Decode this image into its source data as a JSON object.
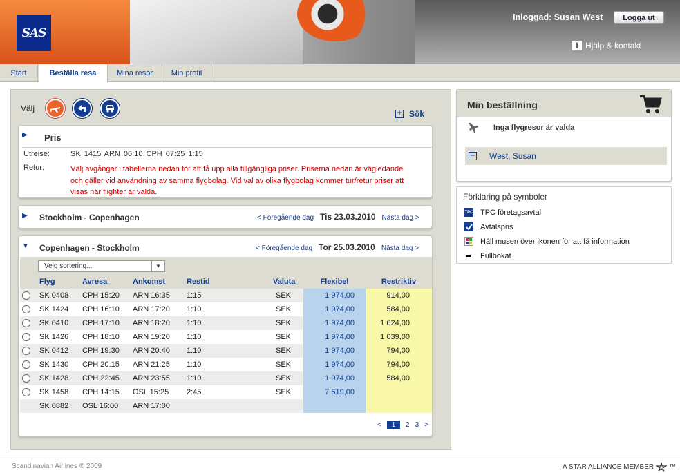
{
  "brand": {
    "logo_text": "SAS",
    "orange": "#e8642a",
    "blue": "#123d91"
  },
  "header": {
    "logged_in": "Inloggad: Susan West",
    "logout": "Logga ut",
    "help": "Hjälp & kontakt"
  },
  "nav": {
    "tabs": [
      {
        "label": "Start",
        "active": false
      },
      {
        "label": "Beställa resa",
        "active": true
      },
      {
        "label": "Mina resor",
        "active": false
      },
      {
        "label": "Min profil",
        "active": false
      }
    ]
  },
  "search_bar": {
    "choose_label": "Välj",
    "modes": [
      "airplane-icon",
      "hotel-icon",
      "car-icon"
    ],
    "search_label": "Sök"
  },
  "price_panel": {
    "title": "Pris",
    "outbound_label": "Utreise:",
    "outbound_value": "SK 1415  ARN 06:10  CPH 07:25  1:15",
    "return_label": "Retur:",
    "return_message": "Välj avgångar i tabellerna nedan för att få upp alla tillgängliga priser. Priserna nedan är vägledande och gäller vid användning av samma flygbolag. Vid val av olika flygbolag kommer tur/retur priser att visas när flighter är valda."
  },
  "leg_outbound": {
    "title": "Stockholm - Copenhagen",
    "prev": "< Föregående dag",
    "date": "Tis 23.03.2010",
    "next": "Nästa dag >"
  },
  "leg_return": {
    "title": "Copenhagen - Stockholm",
    "prev": "< Föregående dag",
    "date": "Tor 25.03.2010",
    "next": "Nästa dag >",
    "sort_placeholder": "Velg sortering...",
    "columns": [
      "Flyg",
      "Avresa",
      "Ankomst",
      "Restid",
      "Valuta",
      "Flexibel",
      "Restriktiv"
    ],
    "rows": [
      {
        "flight": "SK 0408",
        "dep": "CPH 15:20",
        "arr": "ARN 16:35",
        "time": "1:15",
        "cur": "SEK",
        "flex": "1 974,00",
        "restr": "914,00",
        "radio": true
      },
      {
        "flight": "SK 1424",
        "dep": "CPH 16:10",
        "arr": "ARN 17:20",
        "time": "1:10",
        "cur": "SEK",
        "flex": "1 974,00",
        "restr": "584,00",
        "radio": true
      },
      {
        "flight": "SK 0410",
        "dep": "CPH 17:10",
        "arr": "ARN 18:20",
        "time": "1:10",
        "cur": "SEK",
        "flex": "1 974,00",
        "restr": "1 624,00",
        "radio": true
      },
      {
        "flight": "SK 1426",
        "dep": "CPH 18:10",
        "arr": "ARN 19:20",
        "time": "1:10",
        "cur": "SEK",
        "flex": "1 974,00",
        "restr": "1 039,00",
        "radio": true
      },
      {
        "flight": "SK 0412",
        "dep": "CPH 19:30",
        "arr": "ARN 20:40",
        "time": "1:10",
        "cur": "SEK",
        "flex": "1 974,00",
        "restr": "794,00",
        "radio": true
      },
      {
        "flight": "SK 1430",
        "dep": "CPH 20:15",
        "arr": "ARN 21:25",
        "time": "1:10",
        "cur": "SEK",
        "flex": "1 974,00",
        "restr": "794,00",
        "radio": true
      },
      {
        "flight": "SK 1428",
        "dep": "CPH 22:45",
        "arr": "ARN 23:55",
        "time": "1:10",
        "cur": "SEK",
        "flex": "1 974,00",
        "restr": "584,00",
        "radio": true
      },
      {
        "flight": "SK 1458",
        "dep": "CPH 14:15",
        "arr": "OSL 15:25",
        "time": "2:45",
        "cur": "SEK",
        "flex": "7 619,00",
        "restr": "",
        "radio": true
      },
      {
        "flight": "SK 0882",
        "dep": "OSL 16:00",
        "arr": "ARN 17:00",
        "time": "",
        "cur": "",
        "flex": "",
        "restr": "",
        "radio": false
      }
    ],
    "pager": {
      "prev": "<",
      "pages": [
        "1",
        "2",
        "3"
      ],
      "current": "1",
      "next": ">"
    }
  },
  "booking": {
    "title": "Min beställning",
    "no_flights": "Inga flygresor är valda",
    "passenger": "West, Susan"
  },
  "legend": {
    "title": "Förklaring på symboler",
    "items": [
      {
        "icon": "tpc-icon",
        "text": "TPC företagsavtal"
      },
      {
        "icon": "checkbox-icon",
        "text": "Avtalspris"
      },
      {
        "icon": "info-hover-icon",
        "text": "Håll musen över ikonen för att få information"
      },
      {
        "icon": "dash-icon",
        "text": "Fullbokat"
      }
    ],
    "tpc_badge": "TPC"
  },
  "footer": {
    "copyright": "Scandinavian Airlines © 2009",
    "alliance": "A STAR ALLIANCE MEMBER",
    "tm": "™"
  }
}
